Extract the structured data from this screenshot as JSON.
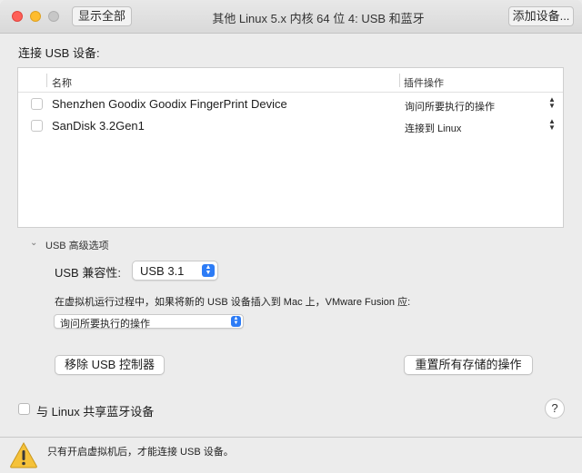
{
  "titlebar": {
    "show_all_label": "显示全部",
    "title": "其他 Linux 5.x 内核 64 位 4: USB 和蓝牙",
    "add_device_label": "添加设备..."
  },
  "usb": {
    "section_label": "连接 USB 设备:",
    "columns": {
      "name": "名称",
      "action": "插件操作"
    },
    "devices": [
      {
        "name": "Shenzhen Goodix Goodix FingerPrint Device",
        "action": "询问所要执行的操作"
      },
      {
        "name": "SanDisk 3.2Gen1",
        "action": "连接到 Linux"
      }
    ]
  },
  "advanced": {
    "title": "USB 高级选项",
    "compat_label": "USB 兼容性:",
    "compat_value": "USB 3.1",
    "vm_question": "在虚拟机运行过程中，如果将新的 USB 设备插入到 Mac 上，VMware Fusion 应:",
    "vm_action_value": "询问所要执行的操作",
    "remove_controller_label": "移除 USB 控制器",
    "reset_storage_label": "重置所有存储的操作"
  },
  "bluetooth": {
    "share_label": "与 Linux 共享蓝牙设备"
  },
  "help_label": "?",
  "footer": {
    "warning_text": "只有开启虚拟机后，才能连接 USB 设备。"
  },
  "colors": {
    "accent": "#2d7cf6",
    "close": "#fe5f57",
    "minimize": "#febc2e"
  },
  "icons": {
    "close": "close-icon",
    "minimize": "minimize-icon",
    "zoom": "zoom-icon",
    "warning": "warning-icon",
    "updown": "chevron-updown-icon"
  }
}
